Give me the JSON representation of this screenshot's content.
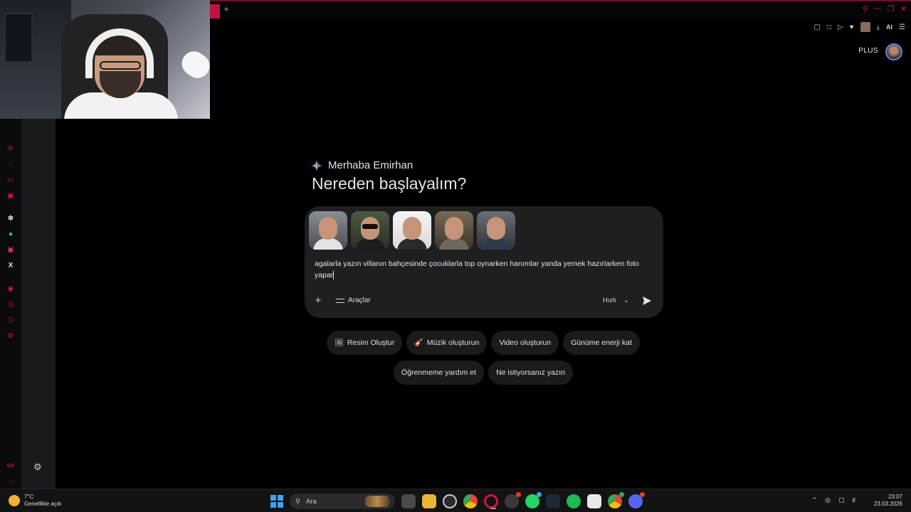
{
  "browser": {
    "new_tab_symbol": "+",
    "window_controls": [
      "search-icon",
      "minimize-icon",
      "restore-icon",
      "close-icon"
    ],
    "toolbar_ai_label": "AI",
    "accent": "#c0133f"
  },
  "app": {
    "plan_badge": "PLUS",
    "greeting": "Merhaba Emirhan",
    "headline": "Nereden başlayalım?"
  },
  "composer": {
    "reference_images": [
      "person-photo-1",
      "person-photo-2",
      "person-photo-3",
      "person-photo-4",
      "person-photo-5"
    ],
    "prompt_text": "agalarla yazın villanın bahçesinde çocuklarla top oynarken hanımlar yanda yemek hazırlarken foto yapar",
    "add_symbol": "+",
    "tools_label": "Araçlar",
    "mode_label": "Hızlı",
    "send_icon": "send-icon"
  },
  "suggestions": {
    "row1": [
      {
        "icon": "🖼",
        "label": "Resim Oluştur"
      },
      {
        "icon": "🎸",
        "label": "Müzik oluşturun"
      },
      {
        "icon": "",
        "label": "Video oluşturun"
      },
      {
        "icon": "",
        "label": "Günüme enerji kat"
      }
    ],
    "row2": [
      {
        "icon": "",
        "label": "Öğrenmeme yardım et"
      },
      {
        "icon": "",
        "label": "Ne istiyorsanız yazın"
      }
    ]
  },
  "sidebar": {
    "gx_label": "GX",
    "more_symbol": "...",
    "x_symbol": "X"
  },
  "taskbar": {
    "weather_temp": "7°C",
    "weather_desc": "Genellikle açık",
    "search_placeholder": "Ara",
    "time": "23:07",
    "date": "23.03.2026"
  }
}
